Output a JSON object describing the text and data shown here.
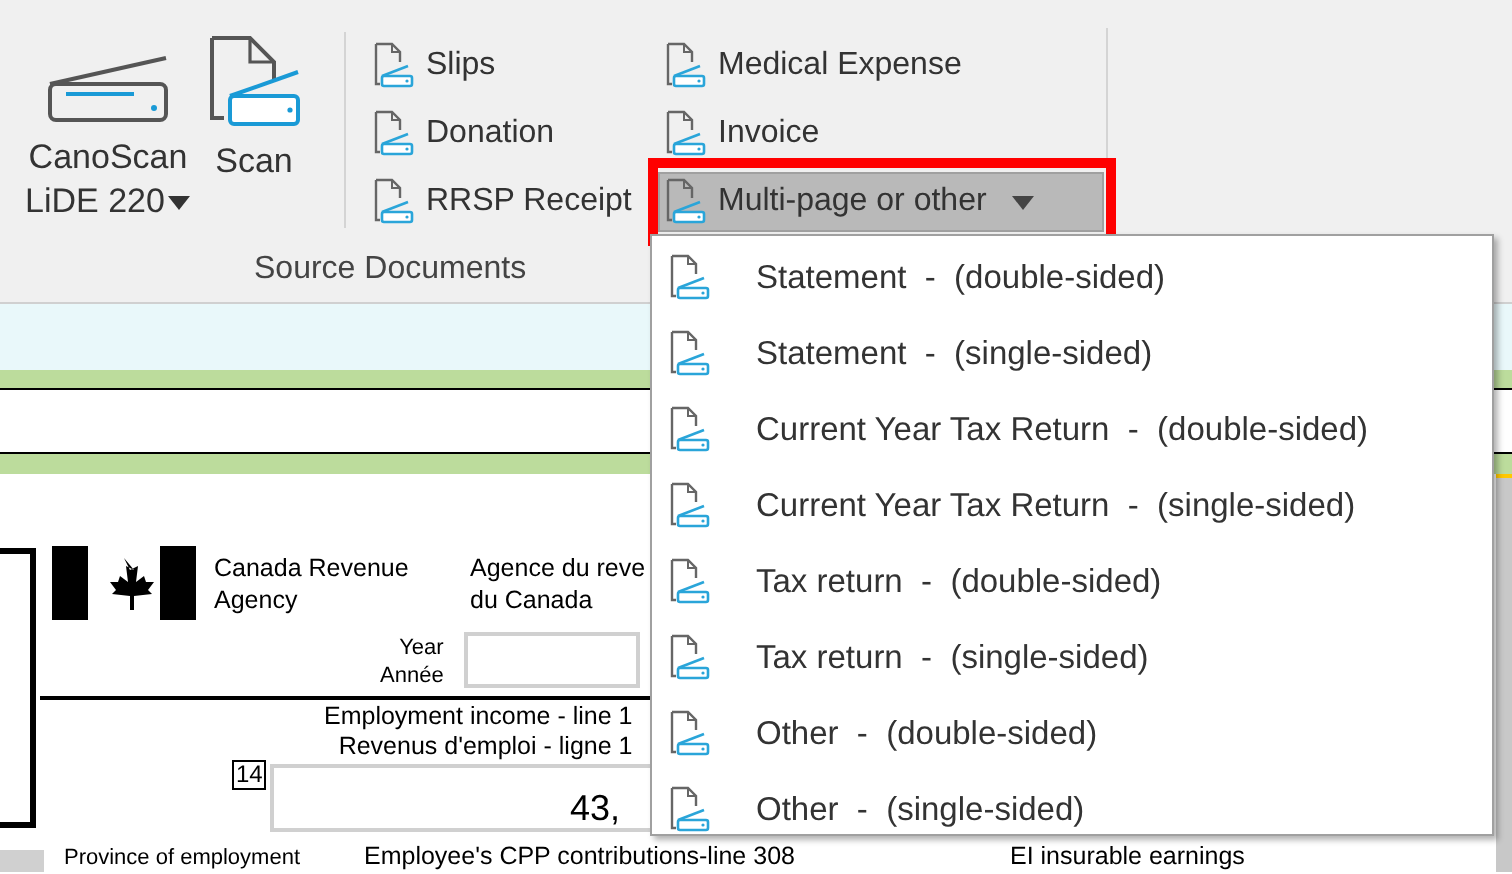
{
  "ribbon": {
    "large_buttons": [
      {
        "kind": "device",
        "lines": [
          "CanoScan",
          "LiDE 220"
        ],
        "dropdown": true
      },
      {
        "kind": "scan",
        "lines": [
          "Scan"
        ],
        "dropdown": false
      }
    ],
    "small_buttons": [
      {
        "label": "Slips",
        "dropdown": false,
        "selected": false,
        "outlined": false
      },
      {
        "label": "Donation",
        "dropdown": false,
        "selected": false,
        "outlined": false
      },
      {
        "label": "RRSP Receipt",
        "dropdown": false,
        "selected": false,
        "outlined": false
      },
      {
        "label": "Medical Expense",
        "dropdown": false,
        "selected": false,
        "outlined": false
      },
      {
        "label": "Invoice",
        "dropdown": false,
        "selected": false,
        "outlined": false
      },
      {
        "label": "Multi-page or other",
        "dropdown": true,
        "selected": true,
        "outlined": true
      }
    ],
    "group_label": "Source Documents"
  },
  "dropdown_menu": {
    "items": [
      {
        "label": "Statement  -  (double-sided)"
      },
      {
        "label": "Statement  -  (single-sided)"
      },
      {
        "label": "Current Year Tax Return  -  (double-sided)"
      },
      {
        "label": "Current Year Tax Return  -  (single-sided)"
      },
      {
        "label": "Tax return  -  (double-sided)"
      },
      {
        "label": "Tax return  -  (single-sided)"
      },
      {
        "label": "Other  -  (double-sided)"
      },
      {
        "label": "Other  -  (single-sided)"
      }
    ]
  },
  "form": {
    "agency_en": [
      "Canada Revenue",
      "Agency"
    ],
    "agency_fr": [
      "Agence du reve",
      "du Canada"
    ],
    "year_label": [
      "Year",
      "Année"
    ],
    "income_label": [
      "Employment income - line 1",
      "Revenus d'emploi - ligne 1"
    ],
    "box_number": "14",
    "amount": "43,",
    "footer_labels": [
      "Province of employment",
      "Employee's CPP contributions-line 308",
      "EI insurable earnings"
    ]
  }
}
